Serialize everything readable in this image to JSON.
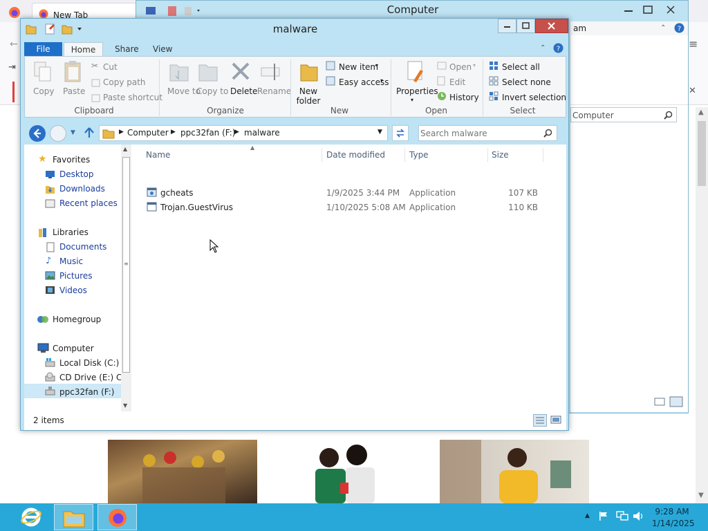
{
  "browser": {
    "tab_title": "New Tab",
    "background_window_title": "Computer",
    "background_search_text": "Computer",
    "background_ribbon_partial": "am"
  },
  "explorer": {
    "title": "malware",
    "ribbon_tabs": [
      "File",
      "Home",
      "Share",
      "View"
    ],
    "clipboard": {
      "copy": "Copy",
      "paste": "Paste",
      "cut": "Cut",
      "copy_path": "Copy path",
      "paste_shortcut": "Paste shortcut",
      "group": "Clipboard"
    },
    "organize": {
      "move_to": "Move to",
      "copy_to": "Copy to",
      "delete": "Delete",
      "rename": "Rename",
      "group": "Organize"
    },
    "new": {
      "new_folder_1": "New",
      "new_folder_2": "folder",
      "new_item": "New item",
      "easy_access": "Easy access",
      "group": "New"
    },
    "open": {
      "properties": "Properties",
      "open": "Open",
      "edit": "Edit",
      "history": "History",
      "group": "Open"
    },
    "select": {
      "select_all": "Select all",
      "select_none": "Select none",
      "invert": "Invert selection",
      "group": "Select"
    },
    "breadcrumb": [
      "Computer",
      "ppc32fan (F:)",
      "malware"
    ],
    "search_placeholder": "Search malware",
    "nav": {
      "favorites": "Favorites",
      "favorites_items": [
        "Desktop",
        "Downloads",
        "Recent places"
      ],
      "libraries": "Libraries",
      "libraries_items": [
        "Documents",
        "Music",
        "Pictures",
        "Videos"
      ],
      "homegroup": "Homegroup",
      "computer": "Computer",
      "computer_items": [
        "Local Disk (C:)",
        "CD Drive (E:) CDF",
        "ppc32fan (F:)"
      ]
    },
    "columns": [
      "Name",
      "Date modified",
      "Type",
      "Size"
    ],
    "files": [
      {
        "name": "gcheats",
        "date": "1/9/2025 3:44 PM",
        "type": "Application",
        "size": "107 KB"
      },
      {
        "name": "Trojan.GuestVirus",
        "date": "1/10/2025 5:08 AM",
        "type": "Application",
        "size": "110 KB"
      }
    ],
    "status": "2 items"
  },
  "taskbar": {
    "time": "9:28 AM",
    "date": "1/14/2025"
  },
  "colors": {
    "taskbar": "#28a8d8",
    "window_frame": "#bde3f4",
    "close_button": "#c7504a",
    "file_tab": "#1e6fc8"
  },
  "icons": [
    "firefox-icon",
    "ie-icon",
    "file-explorer-icon",
    "folder-icon",
    "application-icon",
    "flag-icon",
    "network-icon",
    "speaker-icon"
  ]
}
